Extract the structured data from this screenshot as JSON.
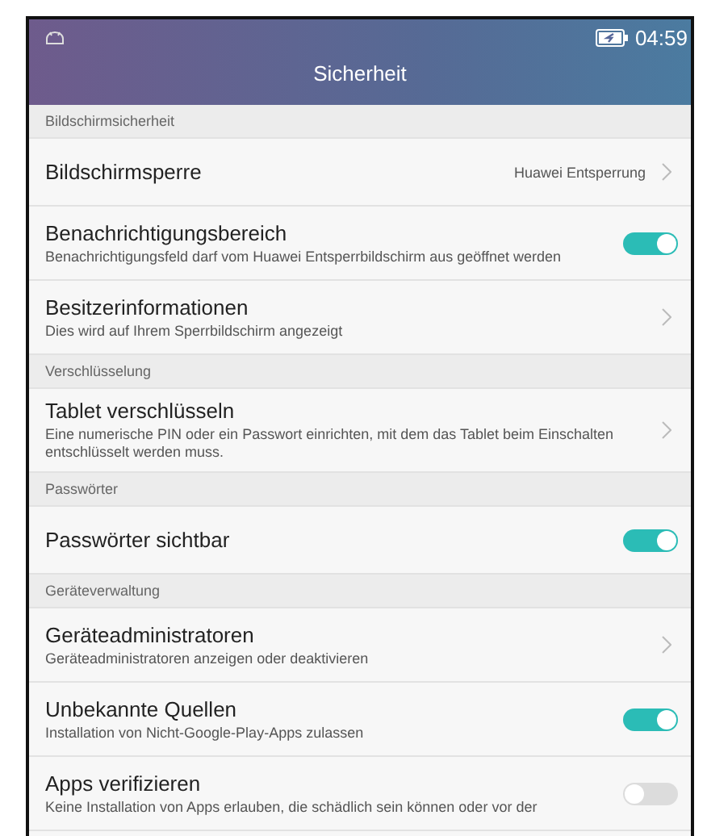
{
  "status_bar": {
    "time": "04:59"
  },
  "title": "Sicherheit",
  "sections": [
    {
      "header": "Bildschirmsicherheit",
      "items": [
        {
          "kind": "nav",
          "title": "Bildschirmsperre",
          "value": "Huawei Entsperrung"
        },
        {
          "kind": "toggle",
          "title": "Benachrichtigungsbereich",
          "subtitle": "Benachrichtigungsfeld darf vom Huawei Entsperrbildschirm aus geöffnet werden",
          "on": true
        },
        {
          "kind": "nav",
          "title": "Besitzerinformationen",
          "subtitle": "Dies wird auf Ihrem Sperrbildschirm angezeigt"
        }
      ]
    },
    {
      "header": "Verschlüsselung",
      "items": [
        {
          "kind": "nav",
          "title": "Tablet verschlüsseln",
          "subtitle": "Eine numerische PIN oder ein Passwort einrichten, mit dem das Tablet beim Einschalten entschlüsselt werden muss."
        }
      ]
    },
    {
      "header": "Passwörter",
      "items": [
        {
          "kind": "toggle",
          "title": "Passwörter sichtbar",
          "on": true
        }
      ]
    },
    {
      "header": "Geräteverwaltung",
      "items": [
        {
          "kind": "nav",
          "title": "Geräteadministratoren",
          "subtitle": "Geräteadministratoren anzeigen oder deaktivieren"
        },
        {
          "kind": "toggle",
          "title": "Unbekannte Quellen",
          "subtitle": "Installation von Nicht-Google-Play-Apps zulassen",
          "on": true
        },
        {
          "kind": "toggle",
          "title": "Apps verifizieren",
          "subtitle": "Keine Installation von Apps erlauben, die schädlich sein können oder vor der",
          "on": false
        }
      ]
    }
  ]
}
